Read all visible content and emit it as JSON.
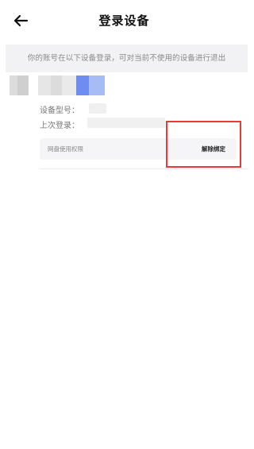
{
  "header": {
    "title": "登录设备",
    "back_icon": "back-arrow-icon"
  },
  "notice": "你的账号在以下设备登录，可对当前不使用的设备进行退出",
  "device": {
    "model_label": "设备型号：",
    "last_login_label": "上次登录：",
    "permission_label": "网盘使用权限",
    "unbind_label": "解除绑定"
  },
  "colors": {
    "highlight": "#e83a3a",
    "notice_bg": "#f2f2f4",
    "avatar_accent": "#6f8df0"
  }
}
